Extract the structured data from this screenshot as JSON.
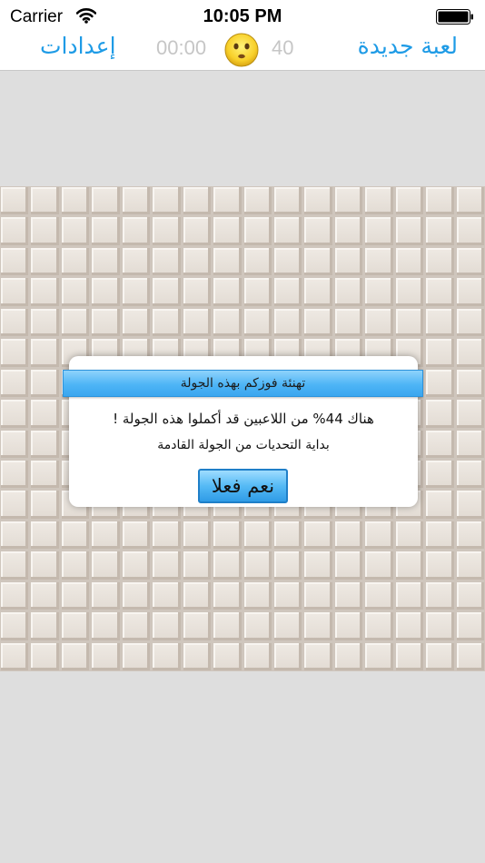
{
  "status_bar": {
    "carrier": "Carrier",
    "time": "10:05 PM"
  },
  "nav": {
    "settings_label": "إعدادات",
    "timer": "00:00",
    "face_icon": "neutral-face-icon",
    "mines_count": "40",
    "new_game_label": "لعبة جديدة"
  },
  "board": {
    "rows": 16,
    "columns": 16
  },
  "dialog": {
    "title": "تهنئة فوزكم بهذه الجولة",
    "message_line1": "هناك 44% من اللاعبين قد أكملوا هذه الجولة !",
    "message_line2": "بداية التحديات من الجولة القادمة",
    "confirm_label": "نعم فعلا"
  },
  "colors": {
    "accent": "#1e9be6",
    "dialog_blue": "#4eb5f6"
  }
}
